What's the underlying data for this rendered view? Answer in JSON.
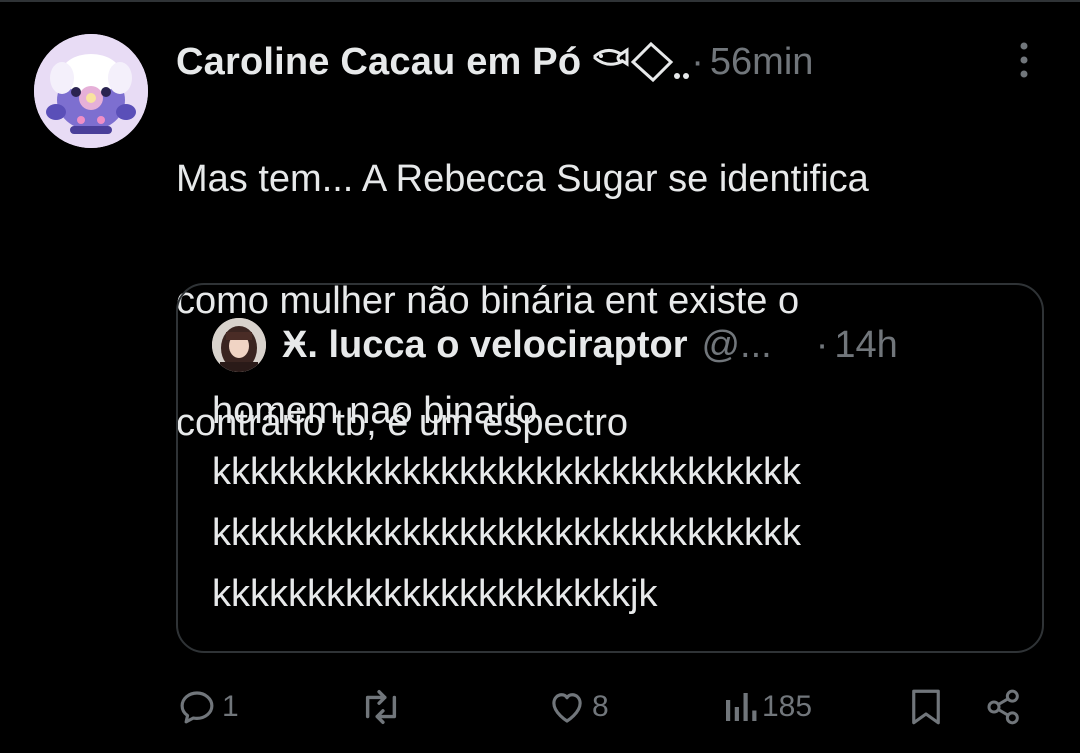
{
  "tweet": {
    "author_name": "Caroline Cacau em Pó",
    "separator": "·",
    "time": "56min",
    "text_lines": [
      "Mas tem... A Rebecca Sugar se identifica",
      "como mulher não binária ent existe o",
      "contrário tb, é um espectro"
    ]
  },
  "quote": {
    "author_name": "Ӿ. lucca o velociraptor",
    "handle": "@...",
    "separator": "·",
    "time": "14h",
    "text_lines": [
      "homem nao binario",
      "kkkkkkkkkkkkkkkkkkkkkkkkkkkkkkk",
      "kkkkkkkkkkkkkkkkkkkkkkkkkkkkkkk",
      "kkkkkkkkkkkkkkkkkkkkkkjk"
    ]
  },
  "actions": {
    "reply_count": "1",
    "retweet_count": "",
    "like_count": "8",
    "views_count": "185"
  },
  "icons": {
    "reply": "reply-icon",
    "retweet": "retweet-icon",
    "like": "heart-icon",
    "views": "views-icon",
    "bookmark": "bookmark-icon",
    "share": "share-icon",
    "more": "more-icon"
  },
  "colors": {
    "background": "#000000",
    "text_primary": "#e7e9ea",
    "text_secondary": "#71767b",
    "border": "#2f3336"
  }
}
